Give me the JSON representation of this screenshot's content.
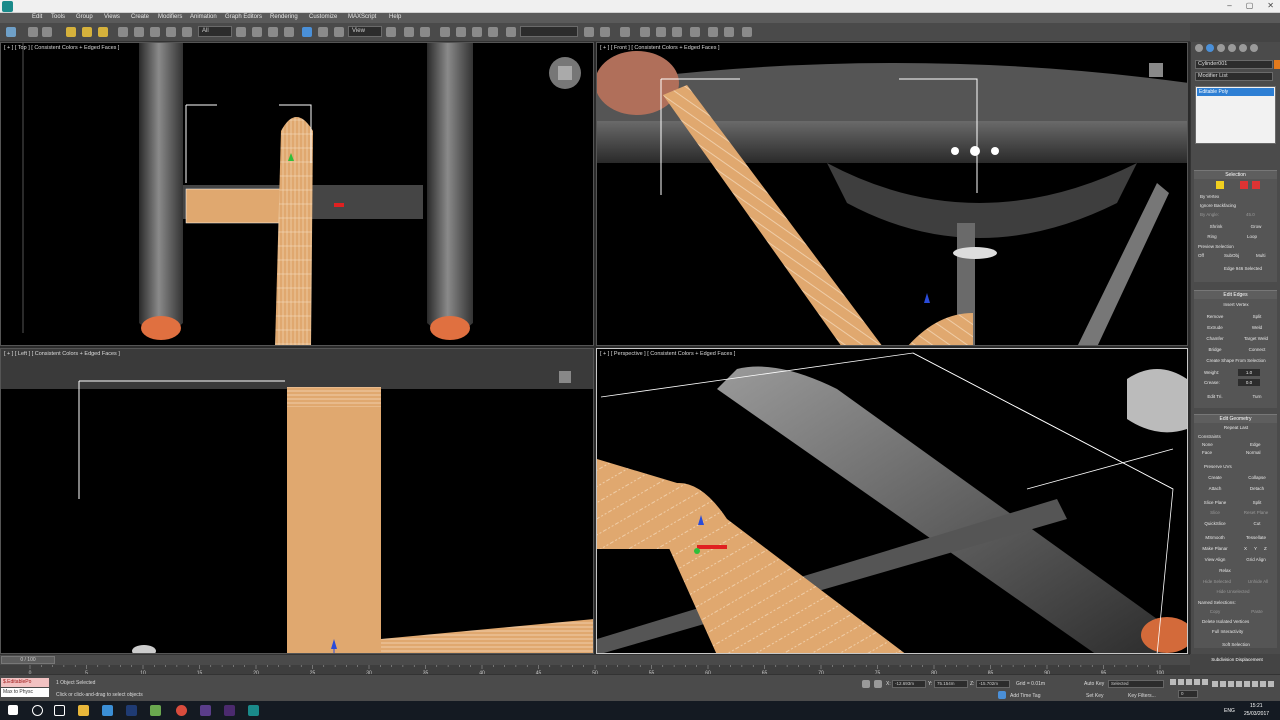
{
  "titlebar": {
    "min": "–",
    "max": "▢",
    "close": "✕"
  },
  "menu": [
    "Edit",
    "Tools",
    "Group",
    "Views",
    "Create",
    "Modifiers",
    "Animation",
    "Graph Editors",
    "Rendering",
    "Customize",
    "MAXScript",
    "Help"
  ],
  "toolbar": {
    "selection_filter": "All",
    "ref_coord": "View"
  },
  "viewports": {
    "top": "[ + ] [ Top ] [ Consistent Colors + Edged Faces ]",
    "front": "[ + ] [ Front ] [ Consistent Colors + Edged Faces ]",
    "left": "[ + ] [ Left ] [ Consistent Colors + Edged Faces ]",
    "perspective": "[ + ] [ Perspective ] [ Consistent Colors + Edged Faces ]"
  },
  "command_panel": {
    "object_name": "Cylinder001",
    "modifier_list": "Modifier List",
    "stack_item": "Editable Poly",
    "selection": {
      "title": "Selection",
      "by_vertex": "By Vertex",
      "ignore_backfacing": "Ignore Backfacing",
      "by_angle": "By Angle:",
      "angle_value": "45.0",
      "shrink": "Shrink",
      "grow": "Grow",
      "ring": "Ring",
      "loop": "Loop",
      "preview_selection": "Preview Selection",
      "off": "Off",
      "subobj": "SubObj",
      "multi": "Multi",
      "status": "Edge 946 Selected"
    },
    "edit_edges": {
      "title": "Edit Edges",
      "insert_vertex": "Insert Vertex",
      "remove": "Remove",
      "split": "Split",
      "extrude": "Extrude",
      "weld": "Weld",
      "chamfer": "Chamfer",
      "target_weld": "Target Weld",
      "bridge": "Bridge",
      "connect": "Connect",
      "create_shape": "Create Shape From Selection",
      "weight": "Weight:",
      "weight_value": "1.0",
      "crease": "Crease:",
      "crease_value": "0.0",
      "edit_tri": "Edit Tri.",
      "turn": "Turn"
    },
    "edit_geometry": {
      "title": "Edit Geometry",
      "repeat_last": "Repeat Last",
      "constraints": "Constraints",
      "none": "None",
      "edge": "Edge",
      "face": "Face",
      "normal": "Normal",
      "preserve_uvs": "Preserve UVs",
      "create": "Create",
      "collapse": "Collapse",
      "attach": "Attach",
      "detach": "Detach",
      "slice_plane": "Slice Plane",
      "split": "Split",
      "slice": "Slice",
      "reset_plane": "Reset Plane",
      "quickslice": "QuickSlice",
      "cut": "Cut",
      "msmooth": "MSmooth",
      "tessellate": "Tessellate",
      "make_planar": "Make Planar",
      "x": "X",
      "y": "Y",
      "z": "Z",
      "view_align": "View Align",
      "grid_align": "Grid Align",
      "relax": "Relax",
      "hide_selected": "Hide Selected",
      "unhide_all": "Unhide All",
      "hide_unselected": "Hide Unselected",
      "named_selections": "Named Selections:",
      "copy": "Copy",
      "paste": "Paste",
      "delete_isolated": "Delete Isolated Vertices",
      "full_interactivity": "Full Interactivity"
    },
    "soft_selection": "Soft Selection",
    "subdivision_displacement": "Subdivision Displacement"
  },
  "timeline": {
    "slider": "0 / 100",
    "ticks": [
      "0",
      "5",
      "10",
      "15",
      "20",
      "25",
      "30",
      "35",
      "40",
      "45",
      "50",
      "55",
      "60",
      "65",
      "70",
      "75",
      "80",
      "85",
      "90",
      "95",
      "100"
    ]
  },
  "status": {
    "maxscript_top": "$.EditablePo",
    "maxscript_bottom": "Max to Physc",
    "objects_selected": "1 Object Selected",
    "prompt": "Click or click-and-drag to select objects",
    "x_label": "X:",
    "x_value": "-12.693m",
    "y_label": "Y:",
    "y_value": "75.154m",
    "z_label": "Z:",
    "z_value": "-15.702m",
    "grid": "Grid = 0.01m",
    "add_time_tag": "Add Time Tag",
    "auto_key": "Auto Key",
    "selected": "Selected",
    "set_key": "Set Key",
    "key_filters": "Key Filters...",
    "frame": "0"
  },
  "taskbar": {
    "time": "15:21",
    "date": "25/03/2017",
    "lang": "ENG"
  },
  "colors": {
    "mesh": "#e0a86f",
    "accent": "#2e7fd4",
    "bg": "#4b4b4b"
  }
}
